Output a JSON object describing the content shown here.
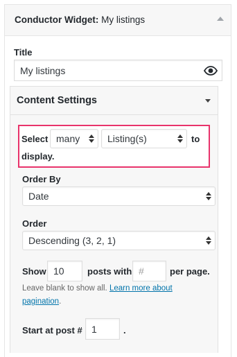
{
  "widget": {
    "title_prefix": "Conductor Widget:",
    "title_instance": "My listings"
  },
  "title_field": {
    "label": "Title",
    "value": "My listings"
  },
  "content_settings": {
    "title": "Content Settings",
    "select_prefix": "Select",
    "count_value": "many",
    "post_type_value": "Listing(s)",
    "to_text": "to",
    "display_text": "display.",
    "order_by": {
      "label": "Order By",
      "value": "Date"
    },
    "order": {
      "label": "Order",
      "value": "Descending (3, 2, 1)"
    },
    "pagination": {
      "show_label": "Show",
      "show_value": "10",
      "posts_with_label": "posts with",
      "per_page_placeholder": "#",
      "per_page_label": "per page.",
      "help_line1": "Leave blank to show all.",
      "help_link_part1": "Learn more about",
      "help_link_part2": "pagination",
      "help_period": "."
    },
    "start_at": {
      "label": "Start at post #",
      "value": "1",
      "period": "."
    }
  },
  "colors": {
    "highlight_border": "#e8336b",
    "link": "#0073aa"
  }
}
